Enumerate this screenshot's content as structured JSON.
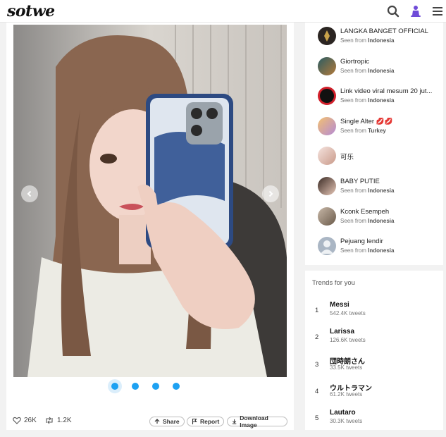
{
  "header": {
    "logo": "sotwe",
    "icons": [
      "search-icon",
      "incognito-user-icon",
      "hamburger-menu-icon"
    ],
    "accent_color": "#6f4bd8"
  },
  "post": {
    "image_alt": "selfie photo",
    "carousel": {
      "count": 4,
      "active_index": 0
    },
    "likes": "26K",
    "retweets": "1.2K",
    "share_label": "Share",
    "report_label": "Report",
    "download_label": "Download Image"
  },
  "users": [
    {
      "name": "LANGKA BANGET OFFICIAL",
      "seen_prefix": "Seen from",
      "location": "Indonesia"
    },
    {
      "name": "Giortropic",
      "seen_prefix": "Seen from",
      "location": "Indonesia"
    },
    {
      "name": "Link video viral mesum 20 jut...",
      "seen_prefix": "Seen from",
      "location": "Indonesia"
    },
    {
      "name": "Single Alter 💋💋",
      "seen_prefix": "Seen from",
      "location": "Turkey"
    },
    {
      "name": "可乐",
      "seen_prefix": "",
      "location": ""
    },
    {
      "name": "BABY PUTIE",
      "seen_prefix": "Seen from",
      "location": "Indonesia"
    },
    {
      "name": "Kconk Esempeh",
      "seen_prefix": "Seen from",
      "location": "Indonesia"
    },
    {
      "name": "Pejuang lendir",
      "seen_prefix": "Seen from",
      "location": "Indonesia"
    }
  ],
  "trends": {
    "title": "Trends for you",
    "items": [
      {
        "rank": "1",
        "name": "Messi",
        "count": "542.4K tweets"
      },
      {
        "rank": "2",
        "name": "Larissa",
        "count": "126.6K tweets"
      },
      {
        "rank": "3",
        "name": "団時朗さん",
        "count": "33.5K tweets"
      },
      {
        "rank": "4",
        "name": "ウルトラマン",
        "count": "61.2K tweets"
      },
      {
        "rank": "5",
        "name": "Lautaro",
        "count": "30.3K tweets"
      }
    ]
  },
  "colors": {
    "link_blue": "#1da1f2",
    "page_bg": "#f2f2f2"
  }
}
